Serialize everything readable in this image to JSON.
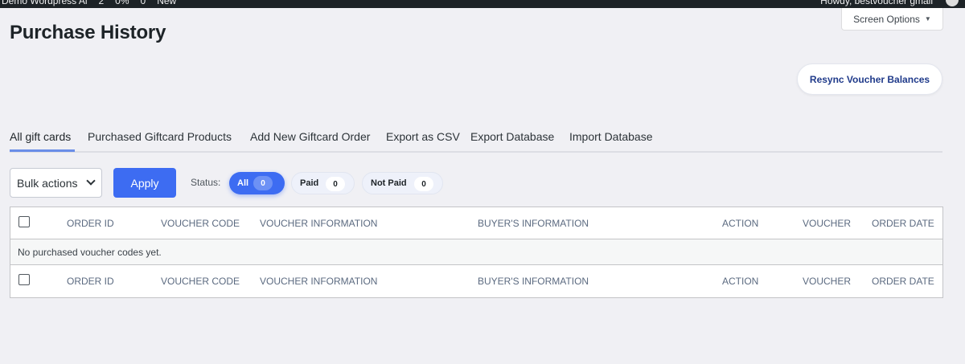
{
  "admin_bar": {
    "site_name": "Demo Wordpress Al",
    "items": [
      "2",
      "0%",
      "0",
      "New"
    ],
    "greeting": "Howdy, bestvoucher gmail"
  },
  "screen_options": {
    "label": "Screen Options"
  },
  "page_title": "Purchase History",
  "resync_button": "Resync Voucher Balances",
  "tabs": [
    {
      "label": "All gift cards",
      "active": true
    },
    {
      "label": "Purchased Giftcard Products"
    },
    {
      "label": "Add New Giftcard Order"
    },
    {
      "label": "Export as CSV"
    },
    {
      "label": "Export Database"
    },
    {
      "label": "Import Database"
    }
  ],
  "bulk_actions": {
    "selected": "Bulk actions"
  },
  "apply_button": "Apply",
  "status_filter": {
    "label": "Status:",
    "options": [
      {
        "label": "All",
        "count": "0",
        "active": true
      },
      {
        "label": "Paid",
        "count": "0"
      },
      {
        "label": "Not Paid",
        "count": "0"
      }
    ]
  },
  "table": {
    "columns": [
      "ORDER ID",
      "VOUCHER CODE",
      "VOUCHER INFORMATION",
      "BUYER'S INFORMATION",
      "ACTION",
      "VOUCHER",
      "ORDER DATE"
    ],
    "empty_message": "No purchased voucher codes yet."
  },
  "colors": {
    "accent": "#3d6cf2",
    "resync_text": "#1f3a8a"
  }
}
